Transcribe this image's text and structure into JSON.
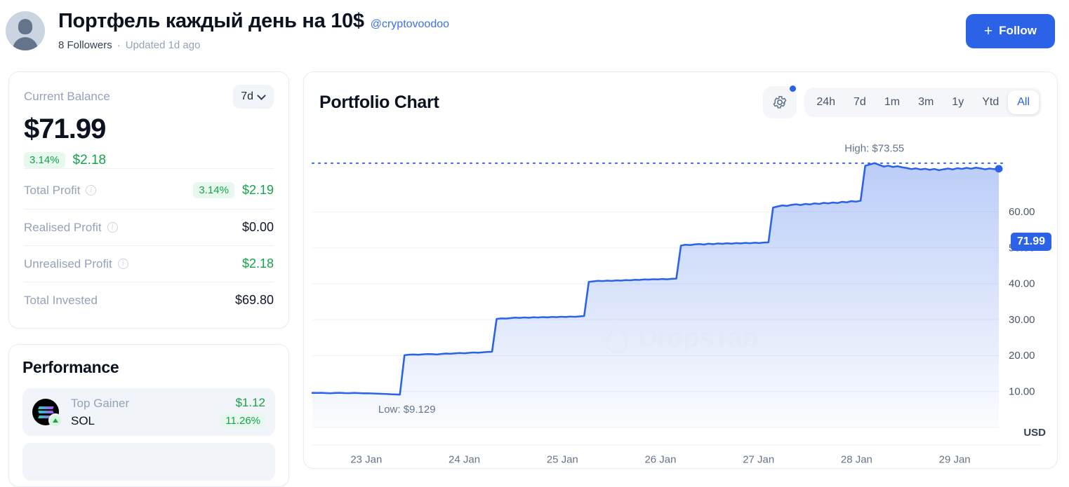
{
  "header": {
    "title": "Портфель каждый день на 10$",
    "handle": "@cryptovoodoo",
    "followers": "8 Followers",
    "separator": "·",
    "updated": "Updated 1d ago",
    "follow_label": "Follow",
    "plus": "+"
  },
  "balance": {
    "label": "Current Balance",
    "range_label": "7d",
    "amount": "$71.99",
    "change_pct": "3.14%",
    "change_value": "$2.18",
    "rows": [
      {
        "label": "Total Profit",
        "pct": "3.14%",
        "value": "$2.19",
        "color": "green"
      },
      {
        "label": "Realised Profit",
        "pct": "",
        "value": "$0.00",
        "color": "dark"
      },
      {
        "label": "Unrealised Profit",
        "pct": "",
        "value": "$2.18",
        "color": "green"
      },
      {
        "label": "Total Invested",
        "pct": "",
        "value": "$69.80",
        "color": "dark"
      }
    ]
  },
  "performance": {
    "title": "Performance",
    "items": [
      {
        "kind": "Top Gainer",
        "symbol": "SOL",
        "amount": "$1.12",
        "pct": "11.26%"
      }
    ]
  },
  "chart": {
    "title": "Portfolio Chart",
    "ranges": [
      "24h",
      "7d",
      "1m",
      "3m",
      "1y",
      "Ytd",
      "All"
    ],
    "active_range": "All",
    "current_price_badge": "71.99",
    "currency": "USD",
    "watermark": "DropsTab",
    "accent_color": "#2b62e8",
    "positive_color": "#17a34a"
  },
  "chart_data": {
    "type": "area",
    "title": "Portfolio Chart",
    "xlabel": "",
    "ylabel": "USD",
    "ylim": [
      0,
      78
    ],
    "yticks": [
      10.0,
      20.0,
      30.0,
      40.0,
      50.0,
      60.0
    ],
    "ytick_labels": [
      "10.00",
      "20.00",
      "30.00",
      "40.00",
      "50.00",
      "60.00"
    ],
    "xticks": [
      "23 Jan",
      "24 Jan",
      "25 Jan",
      "26 Jan",
      "27 Jan",
      "28 Jan",
      "29 Jan"
    ],
    "grid": true,
    "legend": false,
    "annotations": [
      {
        "text": "High: $73.55",
        "value": 73.55,
        "kind": "high"
      },
      {
        "text": "Low: $9.129",
        "value": 9.129,
        "kind": "low"
      }
    ],
    "high": 73.55,
    "low": 9.129,
    "last_value": 71.99,
    "series": [
      {
        "name": "Portfolio Value",
        "color": "#2b62e8",
        "values": [
          9.6,
          9.58,
          9.62,
          9.55,
          9.5,
          9.58,
          9.62,
          9.55,
          9.52,
          9.6,
          9.55,
          9.48,
          9.5,
          9.45,
          9.4,
          9.35,
          9.3,
          9.22,
          9.18,
          9.129,
          20.1,
          20.25,
          20.3,
          20.22,
          20.35,
          20.42,
          20.38,
          20.3,
          20.45,
          20.55,
          20.48,
          20.6,
          20.7,
          20.62,
          20.75,
          20.85,
          20.78,
          20.9,
          21.0,
          21.05,
          30.2,
          30.35,
          30.28,
          30.42,
          30.55,
          30.48,
          30.6,
          30.52,
          30.65,
          30.58,
          30.7,
          30.62,
          30.75,
          30.68,
          30.8,
          30.72,
          30.85,
          30.78,
          30.9,
          31.0,
          40.5,
          40.65,
          40.8,
          40.72,
          40.85,
          40.78,
          40.92,
          40.85,
          41.0,
          40.95,
          41.1,
          41.05,
          41.2,
          41.15,
          41.25,
          41.18,
          41.3,
          41.22,
          41.35,
          41.4,
          50.6,
          50.85,
          50.75,
          50.95,
          51.05,
          50.9,
          51.15,
          51.0,
          51.2,
          51.1,
          51.25,
          51.15,
          51.3,
          51.2,
          51.35,
          51.25,
          51.4,
          51.3,
          51.45,
          51.5,
          61.2,
          61.5,
          61.8,
          61.65,
          61.95,
          62.1,
          61.9,
          62.2,
          62.05,
          62.35,
          62.2,
          62.5,
          62.35,
          62.6,
          62.45,
          62.8,
          62.65,
          63.0,
          62.85,
          63.1,
          72.8,
          73.2,
          73.55,
          73.1,
          72.6,
          72.85,
          72.5,
          72.7,
          72.4,
          72.2,
          71.9,
          72.1,
          71.8,
          72.0,
          71.7,
          71.95,
          71.6,
          71.85,
          72.05,
          71.8,
          72.15,
          71.95,
          72.25,
          72.0,
          72.3,
          72.1,
          71.85,
          72.05,
          71.9,
          71.99
        ]
      }
    ]
  }
}
